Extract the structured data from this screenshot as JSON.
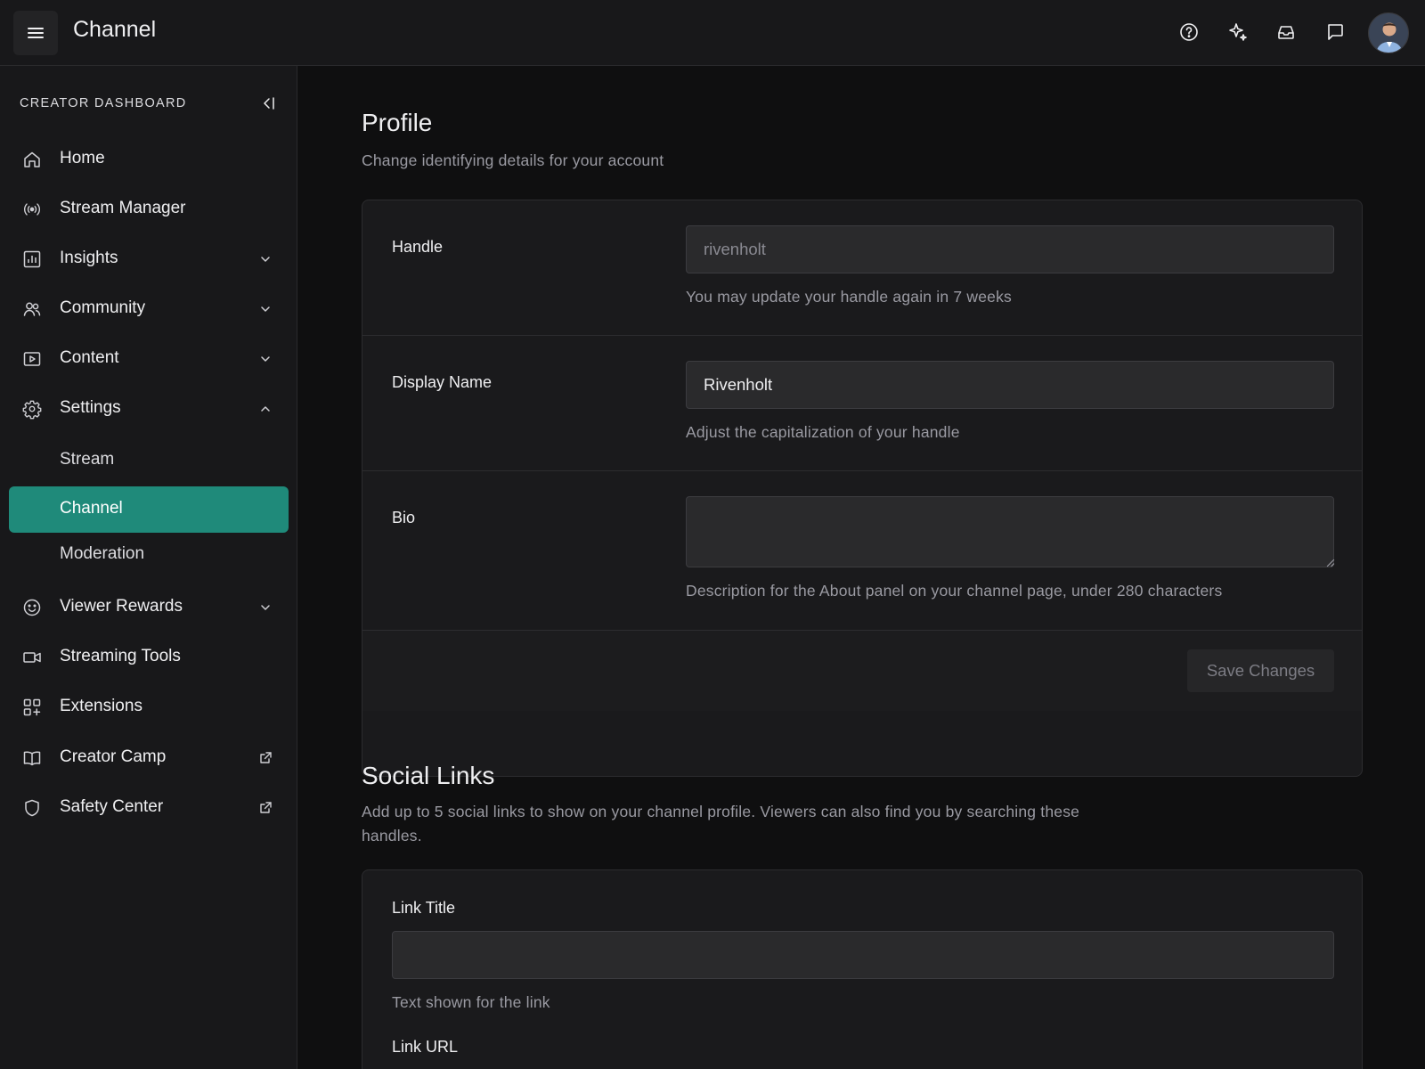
{
  "app": {
    "title": "Channel"
  },
  "topbar": {
    "icons": [
      "menu-icon",
      "help-icon",
      "sparkle-icon",
      "inbox-icon",
      "chat-icon"
    ],
    "avatar_icon": "user-avatar"
  },
  "sidebar": {
    "header": "CREATOR DASHBOARD",
    "items": [
      {
        "label": "Home",
        "icon": "home-icon"
      },
      {
        "label": "Stream Manager",
        "icon": "broadcast-icon"
      },
      {
        "label": "Insights",
        "icon": "chart-icon",
        "expandable": true
      },
      {
        "label": "Community",
        "icon": "users-icon",
        "expandable": true
      },
      {
        "label": "Content",
        "icon": "play-icon",
        "expandable": true
      },
      {
        "label": "Settings",
        "icon": "gear-icon",
        "expandable": true,
        "expanded": true
      },
      {
        "label": "Stream",
        "sub": true
      },
      {
        "label": "Channel",
        "sub": true,
        "active": true
      },
      {
        "label": "Moderation",
        "sub": true
      },
      {
        "label": "Viewer Rewards",
        "icon": "smile-icon",
        "expandable": true
      },
      {
        "label": "Streaming Tools",
        "icon": "video-icon"
      },
      {
        "label": "Extensions",
        "icon": "grid-plus-icon"
      },
      {
        "label": "Creator Camp",
        "icon": "book-icon",
        "external": true
      },
      {
        "label": "Safety Center",
        "icon": "shield-icon",
        "external": true
      }
    ]
  },
  "profile": {
    "title": "Profile",
    "subtitle": "Change identifying details for your account",
    "handle": {
      "label": "Handle",
      "value": "rivenholt",
      "hint": "You may update your handle again in 7 weeks"
    },
    "display_name": {
      "label": "Display Name",
      "value": "Rivenholt",
      "hint": "Adjust the capitalization of your handle"
    },
    "bio": {
      "label": "Bio",
      "value": "",
      "hint": "Description for the About panel on your channel page, under 280 characters"
    },
    "save_label": "Save Changes"
  },
  "social": {
    "title": "Social Links",
    "subtitle_line1": "Add up to 5 social links to show on your channel profile. Viewers can also find you by searching these",
    "subtitle_line2": "handles.",
    "link_title": {
      "label": "Link Title",
      "value": "",
      "hint": "Text shown for the link"
    },
    "link_url": {
      "label": "Link URL"
    }
  },
  "colors": {
    "accent": "#1f8a7a",
    "background": "#0f0f10",
    "panel": "#18181a"
  }
}
